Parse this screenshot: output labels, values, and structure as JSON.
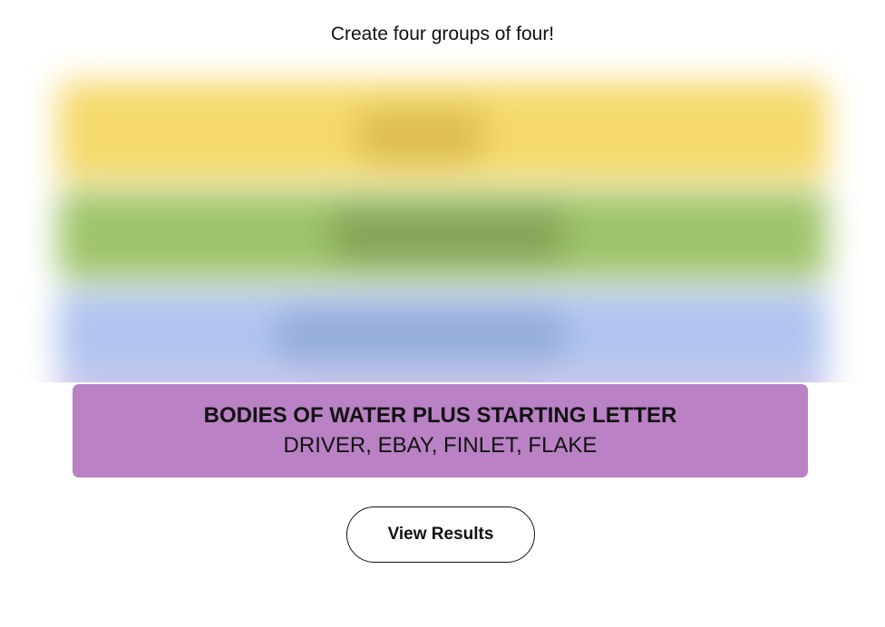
{
  "instructions": "Create four groups of four!",
  "solved_group": {
    "title": "BODIES OF WATER PLUS STARTING LETTER",
    "members": "DRIVER, EBAY, FINLET, FLAKE",
    "color": "#ba81c5"
  },
  "hidden_group_colors": [
    "#f5d96b",
    "#9fc46a",
    "#b0c4ef"
  ],
  "results_button": {
    "label": "View Results"
  }
}
